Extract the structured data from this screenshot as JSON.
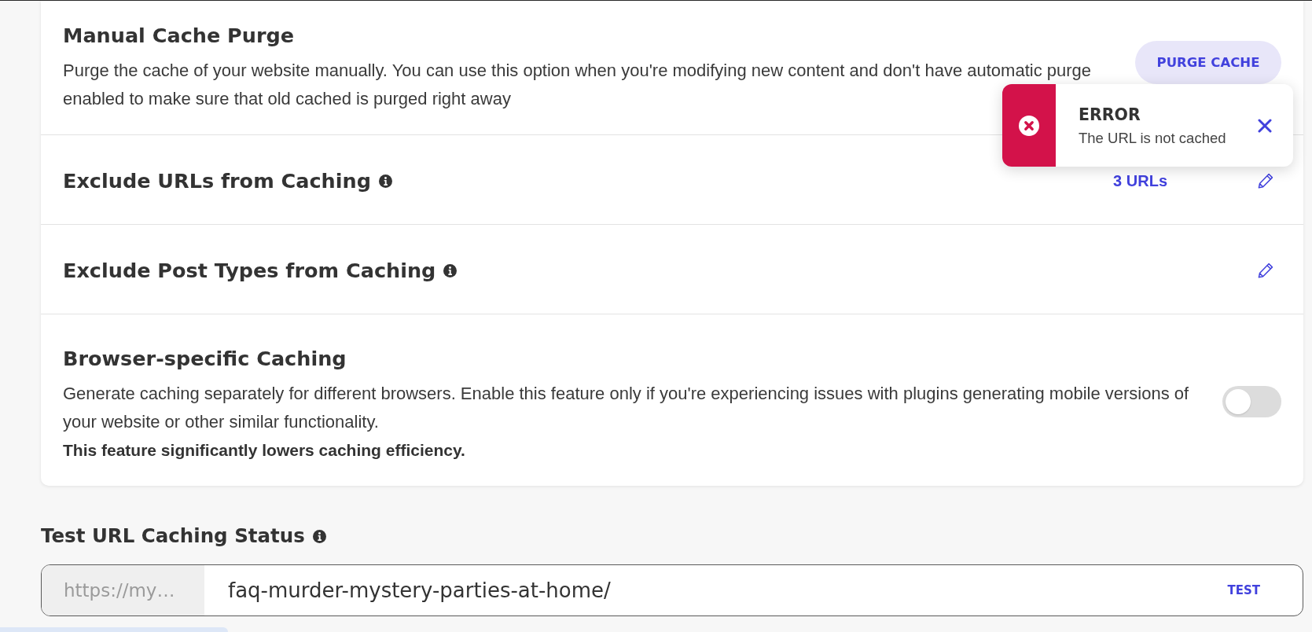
{
  "settings_card": {
    "rows": [
      {
        "kind": "action",
        "title": "Manual Cache Purge",
        "description": "Purge the cache of your website manually. You can use this option when you're modifying new content and don't have automatic purge enabled to make sure that old cached is purged right away",
        "button": "PURGE CACHE"
      },
      {
        "kind": "edit",
        "title": "Exclude URLs from Caching",
        "info": true,
        "count": "3 URLs"
      },
      {
        "kind": "edit",
        "title": "Exclude Post Types from Caching",
        "info": true
      },
      {
        "kind": "toggle",
        "title": "Browser-specific Caching",
        "description": "Generate caching separately for different browsers. Enable this feature only if you're experiencing issues with plugins generating mobile versions of your website or other similar functionality.",
        "warning": "This feature significantly lowers caching efficiency.",
        "on": false
      }
    ]
  },
  "toast": {
    "kind": "error",
    "title": "ERROR",
    "message": "The URL is not cached"
  },
  "test_url": {
    "title": "Test URL Caching Status",
    "info": true,
    "prefix": "https://my…",
    "value": "faq-murder-mystery-parties-at-home/",
    "button": "TEST"
  }
}
